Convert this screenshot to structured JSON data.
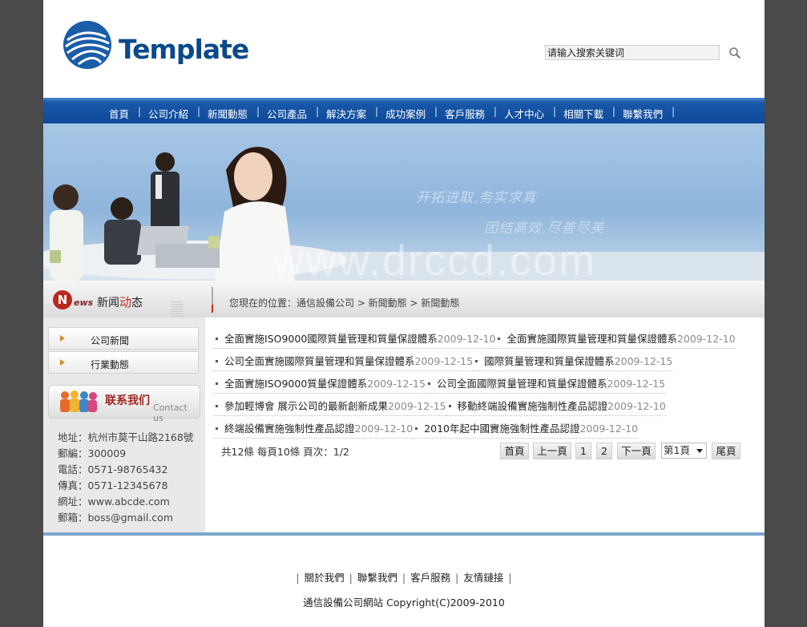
{
  "header": {
    "logo_text": "Template",
    "search_placeholder": "请输入搜索关键词"
  },
  "nav": {
    "items": [
      "首頁",
      "公司介紹",
      "新聞動態",
      "公司產品",
      "解決方案",
      "成功案例",
      "客戶服務",
      "人才中心",
      "相關下載",
      "聯繫我們"
    ]
  },
  "banner": {
    "slogan1": "开拓进取,务实求真",
    "slogan2": "团结高效,尽善尽美",
    "watermark": "www.drccd.com"
  },
  "section": {
    "logo_letter": "N",
    "logo_ews": "ews",
    "title_a": "新闻",
    "title_b": "动",
    "title_c": "态",
    "breadcrumb": "您現在的位置：通信設備公司 > 新聞動態 > 新聞動態"
  },
  "sidebar": {
    "categories": [
      "公司新聞",
      "行業動態"
    ],
    "contact_title": "联系我们",
    "contact_en": "Contact us",
    "address_lines": [
      "地址：杭州市莫干山路2168號",
      "郵編：300009",
      "電話：0571-98765432",
      "傳真：0571-12345678",
      "網址：www.abcde.com",
      "郵箱：boss@gmail.com"
    ]
  },
  "news": [
    [
      {
        "title": "全面實施ISO9000國際質量管理和質量保證體系",
        "date": "2009-12-10"
      },
      {
        "title": "全面實施國際質量管理和質量保證體系",
        "date": "2009-12-10"
      }
    ],
    [
      {
        "title": "公司全面實施國際質量管理和質量保證體系",
        "date": "2009-12-15"
      },
      {
        "title": "國際質量管理和質量保證體系",
        "date": "2009-12-15"
      }
    ],
    [
      {
        "title": "全面實施ISO9000質量保證體系",
        "date": "2009-12-15"
      },
      {
        "title": "公司全面國際質量管理和質量保證體系",
        "date": "2009-12-15"
      }
    ],
    [
      {
        "title": "參加輕博會 展示公司的最新創新成果",
        "date": "2009-12-15"
      },
      {
        "title": "移動終端設備實施強制性產品認證",
        "date": "2009-12-10"
      }
    ],
    [
      {
        "title": "終端設備實施強制性產品認證",
        "date": "2009-12-10"
      },
      {
        "title": "2010年起中國實施強制性產品認證",
        "date": "2009-12-10"
      }
    ]
  ],
  "pager": {
    "info": "共12條 每頁10條 頁次：1/2",
    "first": "首頁",
    "prev": "上一頁",
    "page1": "1",
    "page2": "2",
    "next": "下一頁",
    "select_value": "第1頁",
    "last": "尾頁"
  },
  "footer": {
    "links": [
      "關於我們",
      "聯繫我們",
      "客戶服務",
      "友情鏈接"
    ],
    "copyright": "通信設備公司網站 Copyright(C)2009-2010"
  }
}
